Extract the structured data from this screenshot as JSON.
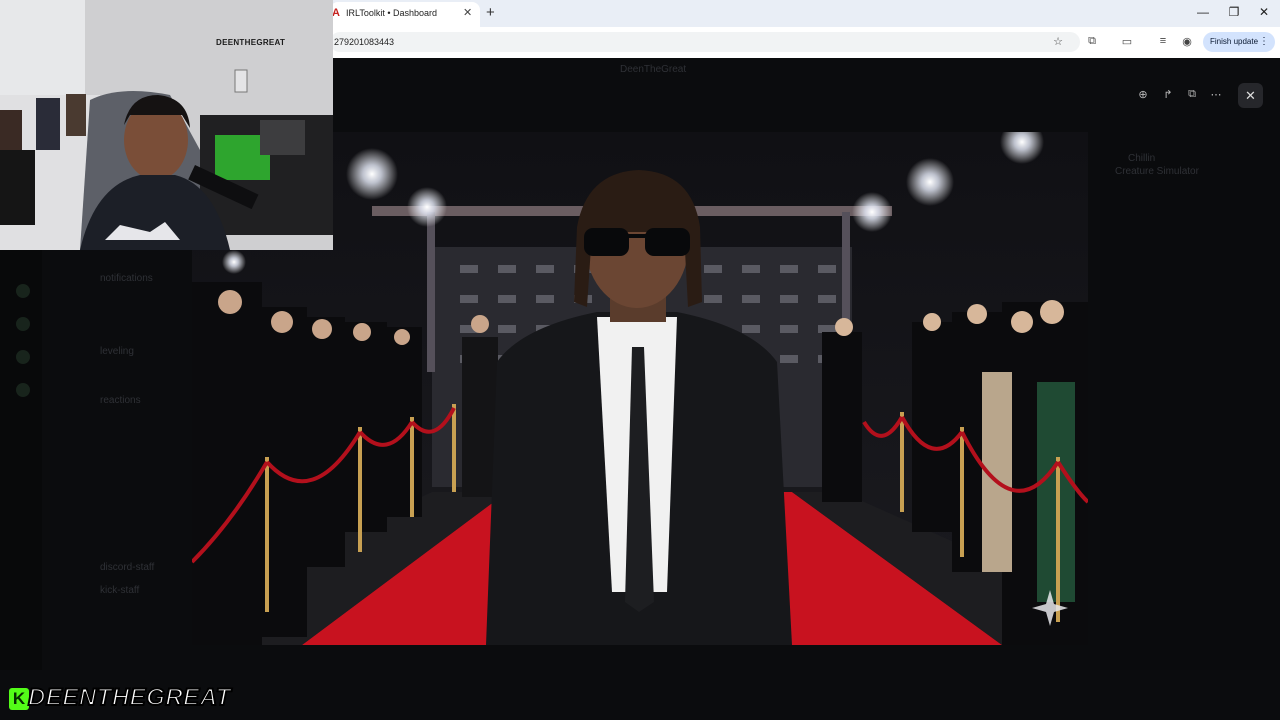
{
  "browser": {
    "tab_title": "IRLToolkit • Dashboard",
    "tab_favicon": "A",
    "new_tab": "+",
    "url": "279201083443",
    "finish_update": "Finish update",
    "minimize": "—",
    "restore": "❐",
    "close": "✕"
  },
  "discord_faint": {
    "header_title": "DeenTheGreat",
    "channels": [
      "notifications",
      "leveling",
      "reactions",
      "discord-staff",
      "kick-staff"
    ],
    "right_panel_title": "Chillin",
    "right_panel_subtitle": "Creature Simulator"
  },
  "viewer": {
    "tools": [
      "zoom-in",
      "rotate",
      "open-external",
      "more"
    ],
    "close_label": "✕"
  },
  "webcam": {
    "wall_logo": "DEENTHEGREAT"
  },
  "overlay": {
    "k_mark": "K",
    "streamer_name": "DEENTHEGREAT"
  },
  "colors": {
    "kick_green": "#53fc18",
    "red_carpet": "#c8121f",
    "finish_update_bg": "#d3e3fd"
  }
}
